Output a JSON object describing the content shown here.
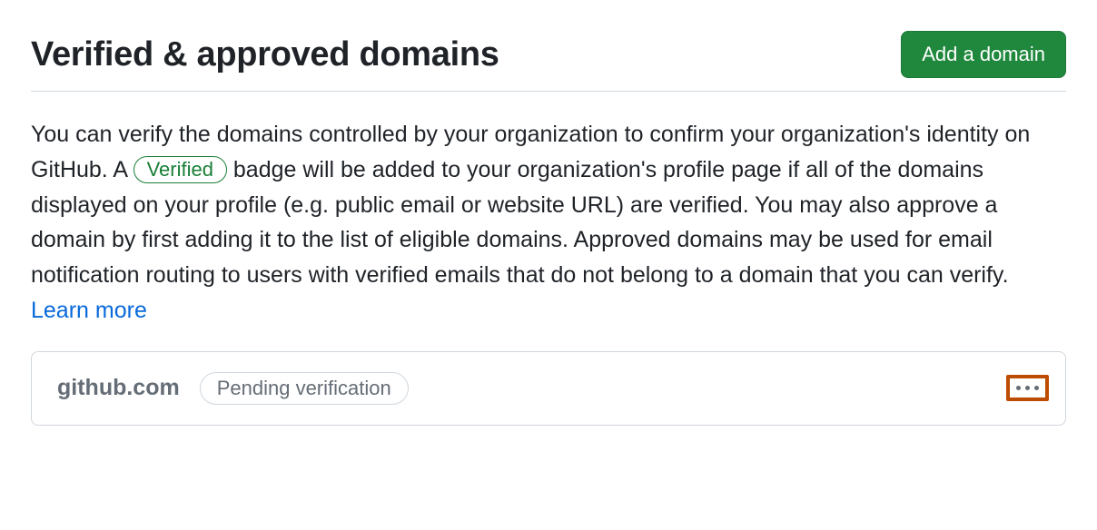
{
  "header": {
    "title": "Verified & approved domains",
    "add_button": "Add a domain"
  },
  "description": {
    "part1": "You can verify the domains controlled by your organization to confirm your organization's identity on GitHub. A ",
    "badge": "Verified",
    "part2": " badge will be added to your organization's profile page if all of the domains displayed on your profile (e.g. public email or website URL) are verified. You may also approve a domain by first adding it to the list of eligible domains. Approved domains may be used for email notification routing to users with verified emails that do not belong to a domain that you can verify. ",
    "learn_more": "Learn more"
  },
  "domain_row": {
    "name": "github.com",
    "status": "Pending verification"
  }
}
